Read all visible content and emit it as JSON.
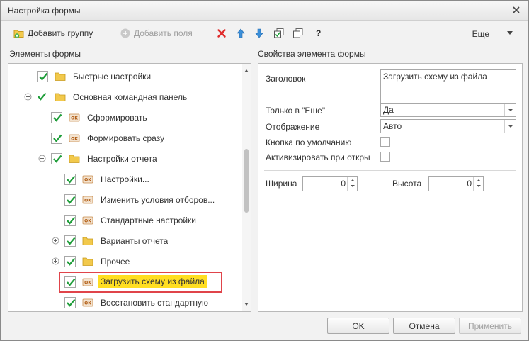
{
  "window": {
    "title": "Настройка формы"
  },
  "toolbar": {
    "add_group_label": "Добавить группу",
    "add_fields_label": "Добавить поля",
    "help_label": "?",
    "more_label": "Еще"
  },
  "left_panel": {
    "title": "Элементы формы",
    "items": [
      {
        "label": "Быстрые настройки",
        "icon": "folder-icon",
        "checked": true,
        "level": 0
      },
      {
        "label": "Основная командная панель",
        "icon": "folder-icon",
        "checked": true,
        "level": 0,
        "expander": "minus"
      },
      {
        "label": "Сформировать",
        "icon": "ok-button-icon",
        "checked": true,
        "level": 1
      },
      {
        "label": "Формировать сразу",
        "icon": "ok-button-icon",
        "checked": true,
        "level": 1
      },
      {
        "label": "Настройки отчета",
        "icon": "folder-icon",
        "checked": true,
        "level": 1,
        "expander": "minus"
      },
      {
        "label": "Настройки...",
        "icon": "ok-button-icon",
        "checked": true,
        "level": 2
      },
      {
        "label": "Изменить условия отборов...",
        "icon": "ok-button-icon",
        "checked": true,
        "level": 2
      },
      {
        "label": "Стандартные настройки",
        "icon": "ok-button-icon",
        "checked": true,
        "level": 2
      },
      {
        "label": "Варианты отчета",
        "icon": "folder-icon",
        "checked": true,
        "level": 2,
        "expander": "plus"
      },
      {
        "label": "Прочее",
        "icon": "folder-icon",
        "checked": true,
        "level": 2,
        "expander": "plus"
      },
      {
        "label": "Загрузить схему из файла",
        "icon": "ok-button-icon",
        "checked": true,
        "level": 2,
        "selected": true
      },
      {
        "label": "Восстановить стандартную",
        "icon": "ok-button-icon",
        "checked": true,
        "level": 2
      }
    ]
  },
  "right_panel": {
    "title": "Свойства элемента формы",
    "heading_label": "Заголовок",
    "heading_value": "Загрузить схему из файла",
    "only_more_label": "Только в \"Еще\"",
    "only_more_value": "Да",
    "display_label": "Отображение",
    "display_value": "Авто",
    "default_button_label": "Кнопка по умолчанию",
    "activate_label": "Активизировать при откры",
    "width_label": "Ширина",
    "width_value": "0",
    "height_label": "Высота",
    "height_value": "0"
  },
  "buttons": {
    "ok": "OK",
    "cancel": "Отмена",
    "apply": "Применить"
  },
  "colors": {
    "selection": "#ffde21",
    "highlight_frame": "#e0444a",
    "check_green": "#1f9e3a",
    "folder_yellow": "#f2c94c"
  }
}
